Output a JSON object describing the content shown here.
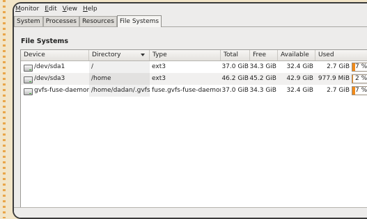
{
  "menu": [
    "Monitor",
    "Edit",
    "View",
    "Help"
  ],
  "tabs": [
    "System",
    "Processes",
    "Resources",
    "File Systems"
  ],
  "active_tab": 3,
  "section_title": "File Systems",
  "columns": [
    "Device",
    "Directory",
    "Type",
    "Total",
    "Free",
    "Available",
    "Used"
  ],
  "sorted_column": "Directory",
  "rows": [
    {
      "device": "/dev/sda1",
      "directory": "/",
      "type": "ext3",
      "total": "37.0 GiB",
      "free": "34.3 GiB",
      "available": "32.4 GiB",
      "used": "2.7 GiB",
      "pct_label": "7 %",
      "pct": 0.07
    },
    {
      "device": "/dev/sda3",
      "directory": "/home",
      "type": "ext3",
      "total": "46.2 GiB",
      "free": "45.2 GiB",
      "available": "42.9 GiB",
      "used": "977.9 MiB",
      "pct_label": "2 %",
      "pct": 0.02
    },
    {
      "device": "gvfs-fuse-daemon",
      "directory": "/home/dadan/.gvfs",
      "type": "fuse.gvfs-fuse-daemon",
      "total": "37.0 GiB",
      "free": "34.3 GiB",
      "available": "32.4 GiB",
      "used": "2.7 GiB",
      "pct_label": "7 %",
      "pct": 0.07
    }
  ],
  "colors": {
    "accent": "#f08a1a",
    "desktop": "#f2e5c8"
  }
}
